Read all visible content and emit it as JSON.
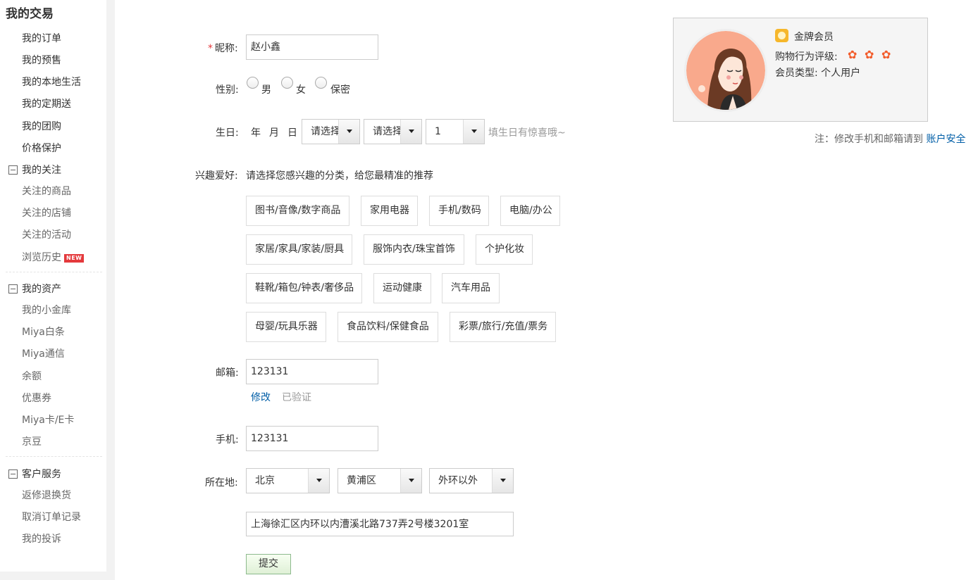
{
  "sidebar": {
    "title": "我的交易",
    "trade_items": [
      "我的订单",
      "我的预售",
      "我的本地生活",
      "我的定期送",
      "我的团购",
      "价格保护"
    ],
    "follow": {
      "title": "我的关注",
      "items": [
        "关注的商品",
        "关注的店铺",
        "关注的活动",
        "浏览历史"
      ],
      "new_badge": "NEW"
    },
    "assets": {
      "title": "我的资产",
      "items": [
        "我的小金库",
        "Miya白条",
        "Miya通信",
        "余额",
        "优惠券",
        "Miya卡/E卡",
        "京豆"
      ]
    },
    "service": {
      "title": "客户服务",
      "items": [
        "返修退换货",
        "取消订单记录",
        "我的投诉"
      ]
    }
  },
  "form": {
    "nickname": {
      "required_mark": "*",
      "label": "昵称:",
      "value": "赵小鑫"
    },
    "gender": {
      "label": "性别:",
      "options": [
        "男",
        "女",
        "保密"
      ]
    },
    "birthday": {
      "label": "生日:",
      "year_unit": "年",
      "month_unit": "月",
      "day_unit": "日",
      "year_select": "请选择",
      "month_select": "请选择",
      "day_select": "1",
      "hint": "填生日有惊喜哦~"
    },
    "interests": {
      "label": "兴趣爱好:",
      "prompt": "请选择您感兴趣的分类，给您最精准的推荐",
      "tags": [
        "图书/音像/数字商品",
        "家用电器",
        "手机/数码",
        "电脑/办公",
        "家居/家具/家装/厨具",
        "服饰内衣/珠宝首饰",
        "个护化妆",
        "鞋靴/箱包/钟表/奢侈品",
        "运动健康",
        "汽车用品",
        "母婴/玩具乐器",
        "食品饮料/保健食品",
        "彩票/旅行/充值/票务"
      ]
    },
    "email": {
      "label": "邮箱:",
      "value": "123131",
      "modify_link": "修改",
      "verified": "已验证"
    },
    "phone": {
      "label": "手机:",
      "value": "123131"
    },
    "location": {
      "label": "所在地:",
      "province": "北京",
      "district": "黄浦区",
      "area": "外环以外",
      "address": "上海徐汇区内环以内漕溪北路737弄2号楼3201室"
    },
    "submit_label": "提交"
  },
  "profile": {
    "member_level": "金牌会员",
    "rating_label": "购物行为评级:",
    "rating_flowers": 3,
    "member_type_label": "会员类型:",
    "member_type": "个人用户",
    "note_prefix": "注：修改手机和邮箱请到",
    "note_link": "账户安全"
  },
  "colors": {
    "required": "#e4393c",
    "link": "#005ea7",
    "flower": "#f25c2b",
    "new_badge": "#e4393c"
  }
}
